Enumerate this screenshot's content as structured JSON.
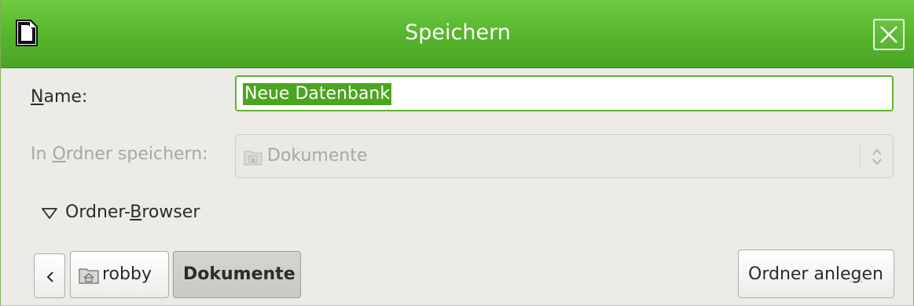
{
  "window": {
    "title": "Speichern"
  },
  "form": {
    "name_label_prefix": "",
    "name_label_mnemonic": "N",
    "name_label_rest": "ame:",
    "name_value": "Neue Datenbank",
    "folder_label_prefix": "In ",
    "folder_label_mnemonic": "O",
    "folder_label_rest": "rdner speichern:",
    "folder_value": "Dokumente"
  },
  "browser": {
    "expander_prefix": "Ordner-",
    "expander_mnemonic": "B",
    "expander_rest": "rowser",
    "breadcrumbs": [
      {
        "label": "robby",
        "icon": "home-folder-icon"
      },
      {
        "label": "Dokumente",
        "active": true
      }
    ],
    "new_folder_prefix": "Ordner anle",
    "new_folder_mnemonic": "g",
    "new_folder_rest": "en"
  },
  "colors": {
    "titlebar": "#55b42b",
    "selection": "#4aa51f",
    "focus_border": "#5fb32d"
  }
}
